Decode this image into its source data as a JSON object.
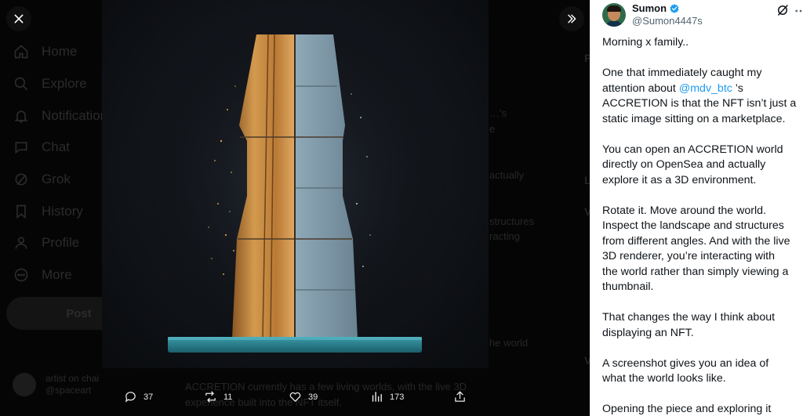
{
  "background": {
    "nav": [
      {
        "label": "Home",
        "icon": "home-icon"
      },
      {
        "label": "Explore",
        "icon": "search-icon"
      },
      {
        "label": "Notifications",
        "icon": "bell-icon"
      },
      {
        "label": "Chat",
        "icon": "chat-icon"
      },
      {
        "label": "Grok",
        "icon": "grok-icon"
      },
      {
        "label": "History",
        "icon": "bookmark-icon"
      },
      {
        "label": "Profile",
        "icon": "person-icon"
      },
      {
        "label": "More",
        "icon": "more-circle-icon"
      }
    ],
    "post_label": "Post",
    "account_name": "artist on chai",
    "account_handle": "@spaceart",
    "snippets": [
      "…’s",
      "e",
      "actually",
      "structures",
      "racting",
      "he world",
      "ACCRETION currently has a few living worlds, with the live 3D",
      "experience built into the NFT itself."
    ]
  },
  "media": {
    "close_icon": "close-icon",
    "expand_icon": "chevrons-right-icon",
    "accent_gold": "#c98a3c",
    "accent_stone": "#7f98a8",
    "base_color": "#2a7f8c"
  },
  "actions": {
    "replies": "37",
    "reposts": "11",
    "likes": "39",
    "views": "173"
  },
  "tweet": {
    "author_name": "Sumon",
    "author_handle": "@Sumon4447s",
    "verified_color": "#1d9bf0",
    "p1": "Morning x family..",
    "p2_pre": "One that immediately caught my",
    "p2_attn": "attention about ",
    "p2_mention": "@mdv_btc",
    "p2_post": " ’s",
    "p2_l3": "ACCRETION is that the NFT isn’t just a",
    "p2_l4": "static image sitting on a marketplace.",
    "p3_l1": "You can open an ACCRETION world",
    "p3_l2": "directly on OpenSea and actually",
    "p3_l3": "explore it as a 3D environment.",
    "p4_l1": "Rotate it. Move around the world.",
    "p4_l2": "Inspect the landscape and structures",
    "p4_l3": "from different angles. And with the live",
    "p4_l4": "3D renderer, you’re interacting with",
    "p4_l5": "the world rather than simply viewing a",
    "p4_l6": "thumbnail.",
    "p5_l1": "That changes the way I think about",
    "p5_l2": "displaying an NFT.",
    "p6_l1": "A screenshot gives you an idea of",
    "p6_l2": "what the world looks like.",
    "p7_l1": "Opening the piece and exploring it"
  }
}
